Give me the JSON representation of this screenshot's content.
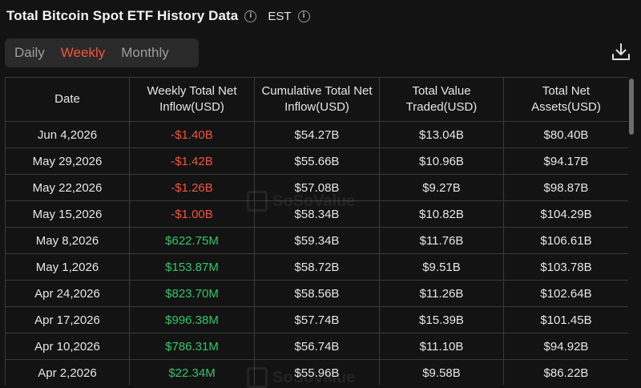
{
  "header": {
    "title": "Total Bitcoin Spot ETF History Data",
    "timezone": "EST"
  },
  "tabs": [
    {
      "label": "Daily",
      "active": false
    },
    {
      "label": "Weekly",
      "active": true
    },
    {
      "label": "Monthly",
      "active": false
    }
  ],
  "table": {
    "columns": [
      "Date",
      "Weekly Total Net Inflow(USD)",
      "Cumulative Total Net Inflow(USD)",
      "Total Value Traded(USD)",
      "Total Net Assets(USD)"
    ],
    "rows": [
      {
        "date": "Jun 4,2026",
        "inflow": "-$1.40B",
        "cumulative": "$54.27B",
        "traded": "$13.04B",
        "assets": "$80.40B",
        "sign": "neg"
      },
      {
        "date": "May 29,2026",
        "inflow": "-$1.42B",
        "cumulative": "$55.66B",
        "traded": "$10.96B",
        "assets": "$94.17B",
        "sign": "neg"
      },
      {
        "date": "May 22,2026",
        "inflow": "-$1.26B",
        "cumulative": "$57.08B",
        "traded": "$9.27B",
        "assets": "$98.87B",
        "sign": "neg"
      },
      {
        "date": "May 15,2026",
        "inflow": "-$1.00B",
        "cumulative": "$58.34B",
        "traded": "$10.82B",
        "assets": "$104.29B",
        "sign": "neg"
      },
      {
        "date": "May 8,2026",
        "inflow": "$622.75M",
        "cumulative": "$59.34B",
        "traded": "$11.76B",
        "assets": "$106.61B",
        "sign": "pos"
      },
      {
        "date": "May 1,2026",
        "inflow": "$153.87M",
        "cumulative": "$58.72B",
        "traded": "$9.51B",
        "assets": "$103.78B",
        "sign": "pos"
      },
      {
        "date": "Apr 24,2026",
        "inflow": "$823.70M",
        "cumulative": "$58.56B",
        "traded": "$11.26B",
        "assets": "$102.64B",
        "sign": "pos"
      },
      {
        "date": "Apr 17,2026",
        "inflow": "$996.38M",
        "cumulative": "$57.74B",
        "traded": "$15.39B",
        "assets": "$101.45B",
        "sign": "pos"
      },
      {
        "date": "Apr 10,2026",
        "inflow": "$786.31M",
        "cumulative": "$56.74B",
        "traded": "$11.10B",
        "assets": "$94.92B",
        "sign": "pos"
      },
      {
        "date": "Apr 2,2026",
        "inflow": "$22.34M",
        "cumulative": "$55.96B",
        "traded": "$9.58B",
        "assets": "$86.22B",
        "sign": "pos"
      }
    ]
  },
  "watermark": "SoSoValue",
  "colors": {
    "negative": "#f0553e",
    "positive": "#34c46b",
    "active_tab": "#f0553e"
  }
}
